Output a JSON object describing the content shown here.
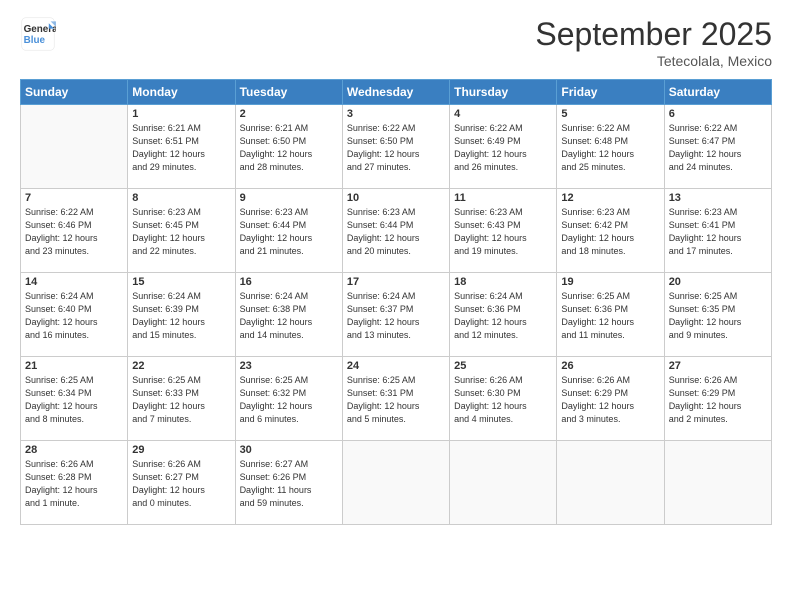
{
  "logo": {
    "line1": "General",
    "line2": "Blue"
  },
  "header": {
    "title": "September 2025",
    "subtitle": "Tetecolala, Mexico"
  },
  "days_of_week": [
    "Sunday",
    "Monday",
    "Tuesday",
    "Wednesday",
    "Thursday",
    "Friday",
    "Saturday"
  ],
  "weeks": [
    [
      {
        "day": "",
        "info": ""
      },
      {
        "day": "1",
        "info": "Sunrise: 6:21 AM\nSunset: 6:51 PM\nDaylight: 12 hours\nand 29 minutes."
      },
      {
        "day": "2",
        "info": "Sunrise: 6:21 AM\nSunset: 6:50 PM\nDaylight: 12 hours\nand 28 minutes."
      },
      {
        "day": "3",
        "info": "Sunrise: 6:22 AM\nSunset: 6:50 PM\nDaylight: 12 hours\nand 27 minutes."
      },
      {
        "day": "4",
        "info": "Sunrise: 6:22 AM\nSunset: 6:49 PM\nDaylight: 12 hours\nand 26 minutes."
      },
      {
        "day": "5",
        "info": "Sunrise: 6:22 AM\nSunset: 6:48 PM\nDaylight: 12 hours\nand 25 minutes."
      },
      {
        "day": "6",
        "info": "Sunrise: 6:22 AM\nSunset: 6:47 PM\nDaylight: 12 hours\nand 24 minutes."
      }
    ],
    [
      {
        "day": "7",
        "info": "Sunrise: 6:22 AM\nSunset: 6:46 PM\nDaylight: 12 hours\nand 23 minutes."
      },
      {
        "day": "8",
        "info": "Sunrise: 6:23 AM\nSunset: 6:45 PM\nDaylight: 12 hours\nand 22 minutes."
      },
      {
        "day": "9",
        "info": "Sunrise: 6:23 AM\nSunset: 6:44 PM\nDaylight: 12 hours\nand 21 minutes."
      },
      {
        "day": "10",
        "info": "Sunrise: 6:23 AM\nSunset: 6:44 PM\nDaylight: 12 hours\nand 20 minutes."
      },
      {
        "day": "11",
        "info": "Sunrise: 6:23 AM\nSunset: 6:43 PM\nDaylight: 12 hours\nand 19 minutes."
      },
      {
        "day": "12",
        "info": "Sunrise: 6:23 AM\nSunset: 6:42 PM\nDaylight: 12 hours\nand 18 minutes."
      },
      {
        "day": "13",
        "info": "Sunrise: 6:23 AM\nSunset: 6:41 PM\nDaylight: 12 hours\nand 17 minutes."
      }
    ],
    [
      {
        "day": "14",
        "info": "Sunrise: 6:24 AM\nSunset: 6:40 PM\nDaylight: 12 hours\nand 16 minutes."
      },
      {
        "day": "15",
        "info": "Sunrise: 6:24 AM\nSunset: 6:39 PM\nDaylight: 12 hours\nand 15 minutes."
      },
      {
        "day": "16",
        "info": "Sunrise: 6:24 AM\nSunset: 6:38 PM\nDaylight: 12 hours\nand 14 minutes."
      },
      {
        "day": "17",
        "info": "Sunrise: 6:24 AM\nSunset: 6:37 PM\nDaylight: 12 hours\nand 13 minutes."
      },
      {
        "day": "18",
        "info": "Sunrise: 6:24 AM\nSunset: 6:36 PM\nDaylight: 12 hours\nand 12 minutes."
      },
      {
        "day": "19",
        "info": "Sunrise: 6:25 AM\nSunset: 6:36 PM\nDaylight: 12 hours\nand 11 minutes."
      },
      {
        "day": "20",
        "info": "Sunrise: 6:25 AM\nSunset: 6:35 PM\nDaylight: 12 hours\nand 9 minutes."
      }
    ],
    [
      {
        "day": "21",
        "info": "Sunrise: 6:25 AM\nSunset: 6:34 PM\nDaylight: 12 hours\nand 8 minutes."
      },
      {
        "day": "22",
        "info": "Sunrise: 6:25 AM\nSunset: 6:33 PM\nDaylight: 12 hours\nand 7 minutes."
      },
      {
        "day": "23",
        "info": "Sunrise: 6:25 AM\nSunset: 6:32 PM\nDaylight: 12 hours\nand 6 minutes."
      },
      {
        "day": "24",
        "info": "Sunrise: 6:25 AM\nSunset: 6:31 PM\nDaylight: 12 hours\nand 5 minutes."
      },
      {
        "day": "25",
        "info": "Sunrise: 6:26 AM\nSunset: 6:30 PM\nDaylight: 12 hours\nand 4 minutes."
      },
      {
        "day": "26",
        "info": "Sunrise: 6:26 AM\nSunset: 6:29 PM\nDaylight: 12 hours\nand 3 minutes."
      },
      {
        "day": "27",
        "info": "Sunrise: 6:26 AM\nSunset: 6:29 PM\nDaylight: 12 hours\nand 2 minutes."
      }
    ],
    [
      {
        "day": "28",
        "info": "Sunrise: 6:26 AM\nSunset: 6:28 PM\nDaylight: 12 hours\nand 1 minute."
      },
      {
        "day": "29",
        "info": "Sunrise: 6:26 AM\nSunset: 6:27 PM\nDaylight: 12 hours\nand 0 minutes."
      },
      {
        "day": "30",
        "info": "Sunrise: 6:27 AM\nSunset: 6:26 PM\nDaylight: 11 hours\nand 59 minutes."
      },
      {
        "day": "",
        "info": ""
      },
      {
        "day": "",
        "info": ""
      },
      {
        "day": "",
        "info": ""
      },
      {
        "day": "",
        "info": ""
      }
    ]
  ]
}
